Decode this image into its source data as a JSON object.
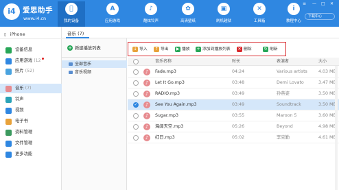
{
  "app": {
    "brand": "爱思助手",
    "url": "www.i4.cn",
    "logo_text": "i4"
  },
  "nav": [
    {
      "label": "我的设备",
      "icon": "apple-icon",
      "glyph": ""
    },
    {
      "label": "应用游戏",
      "icon": "app-store-icon",
      "glyph": "A"
    },
    {
      "label": "酷炫铃声",
      "icon": "bell-icon",
      "glyph": "♪"
    },
    {
      "label": "高清壁纸",
      "icon": "flower-icon",
      "glyph": "✿"
    },
    {
      "label": "刷机越狱",
      "icon": "box-icon",
      "glyph": "▣"
    },
    {
      "label": "工具箱",
      "icon": "toolbox-icon",
      "glyph": "✕"
    },
    {
      "label": "教程中心",
      "icon": "info-icon",
      "glyph": "i"
    }
  ],
  "window_controls": [
    "≡",
    "—",
    "□",
    "✕"
  ],
  "download_center": "下载中心",
  "sidebar": {
    "device": "iPhone",
    "items": [
      {
        "label": "设备信息",
        "count": "",
        "icon": "info-icon",
        "color": "#27a657"
      },
      {
        "label": "应用游戏",
        "count": "(12",
        "icon": "app-icon",
        "color": "#2f87e1",
        "dot": true
      },
      {
        "label": "照片",
        "count": "(52)",
        "icon": "photo-icon",
        "color": "#4aa3df"
      },
      {
        "label": "音乐",
        "count": "(7)",
        "icon": "music-icon",
        "color": "#e78b8f"
      },
      {
        "label": "铃声",
        "count": "",
        "icon": "bell-icon",
        "color": "#2aa3b8"
      },
      {
        "label": "视频",
        "count": "",
        "icon": "video-icon",
        "color": "#2f87e1"
      },
      {
        "label": "电子书",
        "count": "",
        "icon": "book-icon",
        "color": "#e8a23a"
      },
      {
        "label": "资料管理",
        "count": "",
        "icon": "contacts-icon",
        "color": "#3c9a5f"
      },
      {
        "label": "文件管理",
        "count": "",
        "icon": "folder-icon",
        "color": "#2f87e1"
      },
      {
        "label": "更多功能",
        "count": "",
        "icon": "grid-icon",
        "color": "#2f87e1"
      }
    ]
  },
  "tab": {
    "label": "音乐 (7)"
  },
  "playlists": {
    "new_label": "新建播放列表",
    "items": [
      "全部音乐",
      "音乐视频"
    ]
  },
  "toolbar": [
    {
      "label": "导入",
      "icon": "import-icon",
      "color": "#e8a23a",
      "glyph": "↓"
    },
    {
      "label": "导出",
      "icon": "export-icon",
      "color": "#e8a23a",
      "glyph": "↑"
    },
    {
      "label": "播放",
      "icon": "play-icon",
      "color": "#27a657",
      "glyph": "▶"
    },
    {
      "label": "添加到播放列表",
      "icon": "add-playlist-icon",
      "color": "#27a657",
      "glyph": "+"
    },
    {
      "label": "删除",
      "icon": "delete-icon",
      "color": "#d8282c",
      "glyph": "✕"
    },
    {
      "label": "刷新",
      "icon": "refresh-icon",
      "color": "#27a657",
      "glyph": "↻"
    }
  ],
  "table": {
    "columns": [
      "音乐名称",
      "时长",
      "表演者",
      "大小"
    ],
    "rows": [
      {
        "name": "Fade.mp3",
        "time": "04:24",
        "artist": "Various artists",
        "size": "4.03 MB",
        "selected": false
      },
      {
        "name": "Let It Go.mp3",
        "time": "03:48",
        "artist": "Demi Lovato",
        "size": "3.47 MB",
        "selected": false
      },
      {
        "name": "RADIO.mp3",
        "time": "03:49",
        "artist": "孙燕姿",
        "size": "3.50 MB",
        "selected": false
      },
      {
        "name": "See You Again.mp3",
        "time": "03:49",
        "artist": "Soundtrack",
        "size": "3.50 MB",
        "selected": true
      },
      {
        "name": "Sugar.mp3",
        "time": "03:55",
        "artist": "Maroon 5",
        "size": "3.60 MB",
        "selected": false
      },
      {
        "name": "海阔天空.mp3",
        "time": "05:26",
        "artist": "Beyond",
        "size": "4.98 MB",
        "selected": false
      },
      {
        "name": "红日.mp3",
        "time": "05:02",
        "artist": "李克勤",
        "size": "4.61 MB",
        "selected": false
      }
    ]
  }
}
